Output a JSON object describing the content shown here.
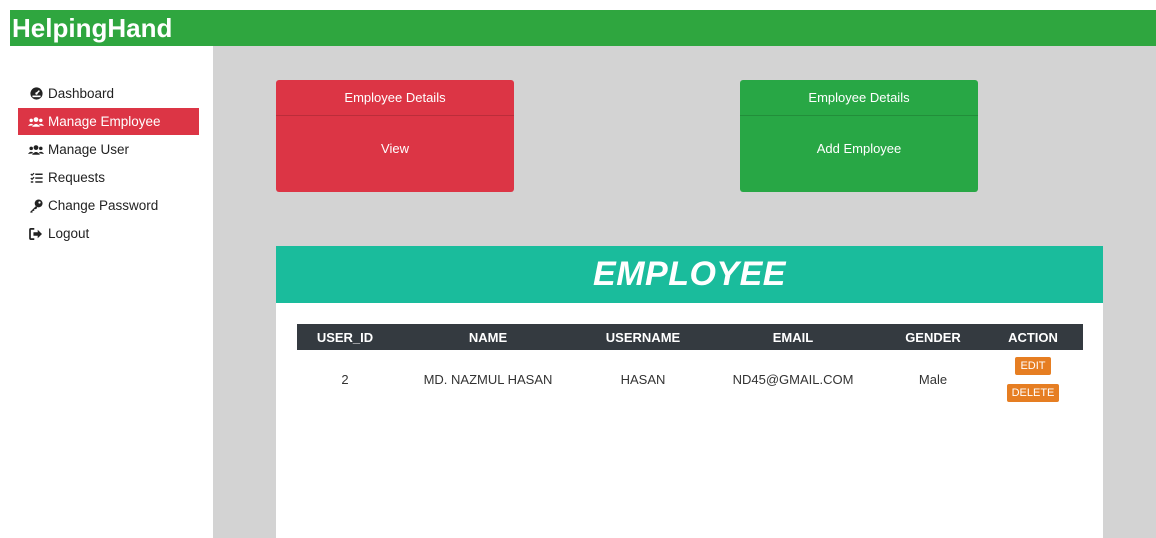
{
  "app": {
    "brand": "HelpingHand"
  },
  "colors": {
    "topbar": "#2fa63f",
    "active_nav": "#dc3545",
    "card_red": "#dc3545",
    "card_green": "#28a745",
    "panel_head": "#1abc9c",
    "table_head": "#343a40",
    "action_btn": "#e67e22"
  },
  "sidebar": {
    "items": [
      {
        "label": "Dashboard",
        "icon": "dashboard-icon",
        "active": false
      },
      {
        "label": "Manage Employee",
        "icon": "users-icon",
        "active": true
      },
      {
        "label": "Manage User",
        "icon": "users-icon",
        "active": false
      },
      {
        "label": "Requests",
        "icon": "list-check-icon",
        "active": false
      },
      {
        "label": "Change Password",
        "icon": "key-icon",
        "active": false
      },
      {
        "label": "Logout",
        "icon": "logout-icon",
        "active": false
      }
    ]
  },
  "cards": [
    {
      "header": "Employee Details",
      "body": "View"
    },
    {
      "header": "Employee Details",
      "body": "Add Employee"
    }
  ],
  "employee_table": {
    "title": "EMPLOYEE",
    "columns": [
      "USER_ID",
      "NAME",
      "USERNAME",
      "EMAIL",
      "GENDER",
      "ACTION"
    ],
    "rows": [
      {
        "user_id": "2",
        "name": "MD. NAZMUL HASAN",
        "username": "HASAN",
        "email": "ND45@GMAIL.COM",
        "gender": "Male",
        "edit_label": "EDIT",
        "delete_label": "DELETE"
      }
    ]
  }
}
